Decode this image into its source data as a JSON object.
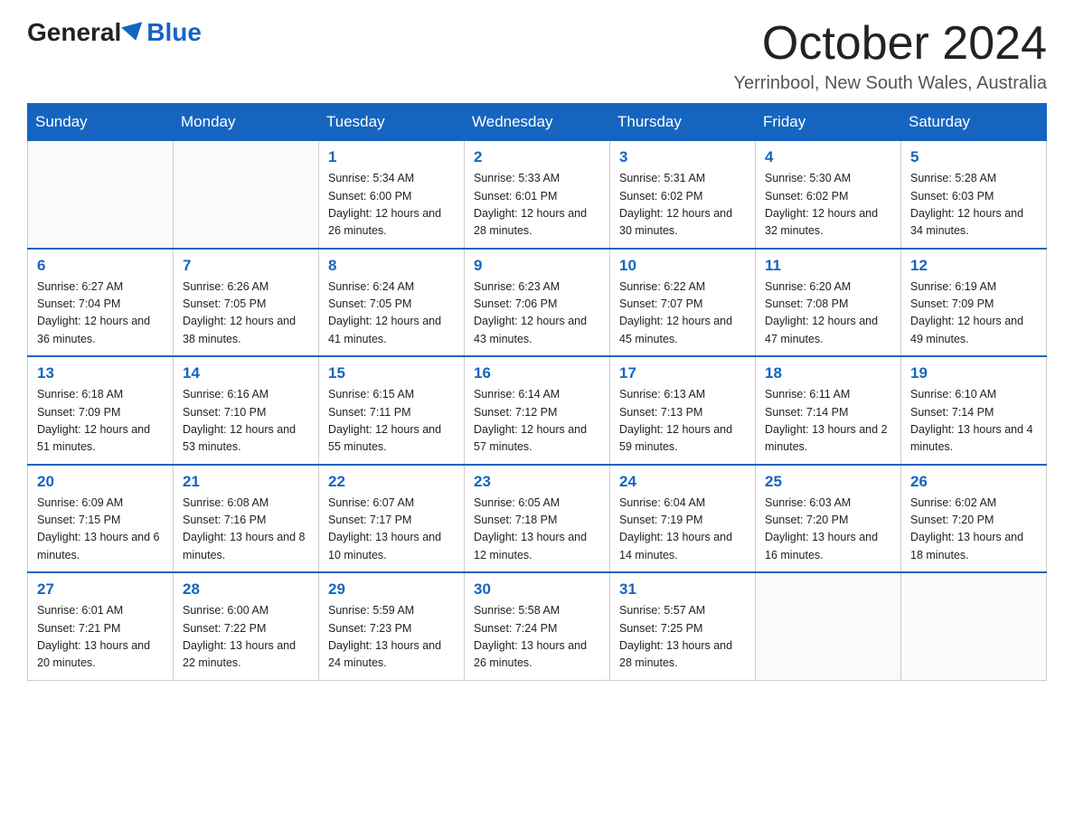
{
  "header": {
    "logo_general": "General",
    "logo_blue": "Blue",
    "month_title": "October 2024",
    "location": "Yerrinbool, New South Wales, Australia"
  },
  "days_of_week": [
    "Sunday",
    "Monday",
    "Tuesday",
    "Wednesday",
    "Thursday",
    "Friday",
    "Saturday"
  ],
  "weeks": [
    [
      {
        "day": "",
        "info": ""
      },
      {
        "day": "",
        "info": ""
      },
      {
        "day": "1",
        "info": "Sunrise: 5:34 AM\nSunset: 6:00 PM\nDaylight: 12 hours\nand 26 minutes."
      },
      {
        "day": "2",
        "info": "Sunrise: 5:33 AM\nSunset: 6:01 PM\nDaylight: 12 hours\nand 28 minutes."
      },
      {
        "day": "3",
        "info": "Sunrise: 5:31 AM\nSunset: 6:02 PM\nDaylight: 12 hours\nand 30 minutes."
      },
      {
        "day": "4",
        "info": "Sunrise: 5:30 AM\nSunset: 6:02 PM\nDaylight: 12 hours\nand 32 minutes."
      },
      {
        "day": "5",
        "info": "Sunrise: 5:28 AM\nSunset: 6:03 PM\nDaylight: 12 hours\nand 34 minutes."
      }
    ],
    [
      {
        "day": "6",
        "info": "Sunrise: 6:27 AM\nSunset: 7:04 PM\nDaylight: 12 hours\nand 36 minutes."
      },
      {
        "day": "7",
        "info": "Sunrise: 6:26 AM\nSunset: 7:05 PM\nDaylight: 12 hours\nand 38 minutes."
      },
      {
        "day": "8",
        "info": "Sunrise: 6:24 AM\nSunset: 7:05 PM\nDaylight: 12 hours\nand 41 minutes."
      },
      {
        "day": "9",
        "info": "Sunrise: 6:23 AM\nSunset: 7:06 PM\nDaylight: 12 hours\nand 43 minutes."
      },
      {
        "day": "10",
        "info": "Sunrise: 6:22 AM\nSunset: 7:07 PM\nDaylight: 12 hours\nand 45 minutes."
      },
      {
        "day": "11",
        "info": "Sunrise: 6:20 AM\nSunset: 7:08 PM\nDaylight: 12 hours\nand 47 minutes."
      },
      {
        "day": "12",
        "info": "Sunrise: 6:19 AM\nSunset: 7:09 PM\nDaylight: 12 hours\nand 49 minutes."
      }
    ],
    [
      {
        "day": "13",
        "info": "Sunrise: 6:18 AM\nSunset: 7:09 PM\nDaylight: 12 hours\nand 51 minutes."
      },
      {
        "day": "14",
        "info": "Sunrise: 6:16 AM\nSunset: 7:10 PM\nDaylight: 12 hours\nand 53 minutes."
      },
      {
        "day": "15",
        "info": "Sunrise: 6:15 AM\nSunset: 7:11 PM\nDaylight: 12 hours\nand 55 minutes."
      },
      {
        "day": "16",
        "info": "Sunrise: 6:14 AM\nSunset: 7:12 PM\nDaylight: 12 hours\nand 57 minutes."
      },
      {
        "day": "17",
        "info": "Sunrise: 6:13 AM\nSunset: 7:13 PM\nDaylight: 12 hours\nand 59 minutes."
      },
      {
        "day": "18",
        "info": "Sunrise: 6:11 AM\nSunset: 7:14 PM\nDaylight: 13 hours\nand 2 minutes."
      },
      {
        "day": "19",
        "info": "Sunrise: 6:10 AM\nSunset: 7:14 PM\nDaylight: 13 hours\nand 4 minutes."
      }
    ],
    [
      {
        "day": "20",
        "info": "Sunrise: 6:09 AM\nSunset: 7:15 PM\nDaylight: 13 hours\nand 6 minutes."
      },
      {
        "day": "21",
        "info": "Sunrise: 6:08 AM\nSunset: 7:16 PM\nDaylight: 13 hours\nand 8 minutes."
      },
      {
        "day": "22",
        "info": "Sunrise: 6:07 AM\nSunset: 7:17 PM\nDaylight: 13 hours\nand 10 minutes."
      },
      {
        "day": "23",
        "info": "Sunrise: 6:05 AM\nSunset: 7:18 PM\nDaylight: 13 hours\nand 12 minutes."
      },
      {
        "day": "24",
        "info": "Sunrise: 6:04 AM\nSunset: 7:19 PM\nDaylight: 13 hours\nand 14 minutes."
      },
      {
        "day": "25",
        "info": "Sunrise: 6:03 AM\nSunset: 7:20 PM\nDaylight: 13 hours\nand 16 minutes."
      },
      {
        "day": "26",
        "info": "Sunrise: 6:02 AM\nSunset: 7:20 PM\nDaylight: 13 hours\nand 18 minutes."
      }
    ],
    [
      {
        "day": "27",
        "info": "Sunrise: 6:01 AM\nSunset: 7:21 PM\nDaylight: 13 hours\nand 20 minutes."
      },
      {
        "day": "28",
        "info": "Sunrise: 6:00 AM\nSunset: 7:22 PM\nDaylight: 13 hours\nand 22 minutes."
      },
      {
        "day": "29",
        "info": "Sunrise: 5:59 AM\nSunset: 7:23 PM\nDaylight: 13 hours\nand 24 minutes."
      },
      {
        "day": "30",
        "info": "Sunrise: 5:58 AM\nSunset: 7:24 PM\nDaylight: 13 hours\nand 26 minutes."
      },
      {
        "day": "31",
        "info": "Sunrise: 5:57 AM\nSunset: 7:25 PM\nDaylight: 13 hours\nand 28 minutes."
      },
      {
        "day": "",
        "info": ""
      },
      {
        "day": "",
        "info": ""
      }
    ]
  ]
}
